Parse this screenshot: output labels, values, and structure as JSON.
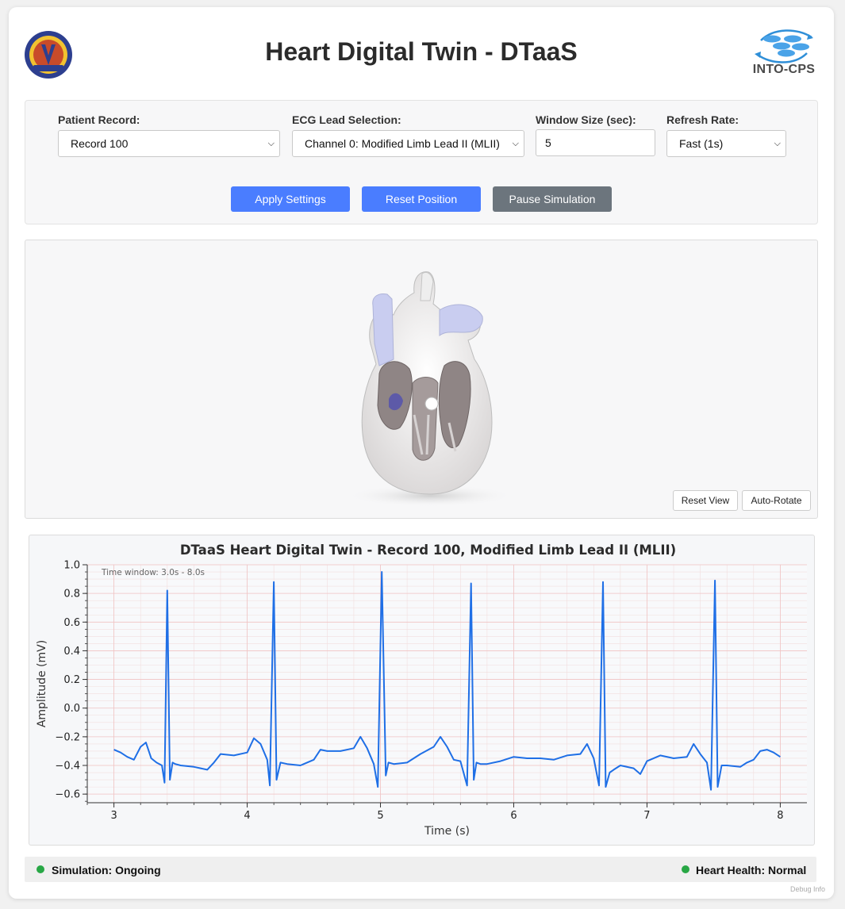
{
  "header": {
    "title": "Heart Digital Twin - DTaaS",
    "right_logo_text": "INTO-CPS"
  },
  "controls": {
    "patient_record": {
      "label": "Patient Record:",
      "value": "Record 100"
    },
    "ecg_lead": {
      "label": "ECG Lead Selection:",
      "value": "Channel 0: Modified Limb Lead II (MLII)"
    },
    "window_size": {
      "label": "Window Size (sec):",
      "value": "5"
    },
    "refresh_rate": {
      "label": "Refresh Rate:",
      "value": "Fast (1s)"
    },
    "buttons": {
      "apply": "Apply Settings",
      "reset_position": "Reset Position",
      "pause": "Pause Simulation"
    }
  },
  "viewer": {
    "reset_view": "Reset View",
    "auto_rotate": "Auto-Rotate"
  },
  "chart_data": {
    "type": "line",
    "title": "DTaaS Heart Digital Twin - Record 100, Modified Limb Lead II (MLII)",
    "xlabel": "Time (s)",
    "ylabel": "Amplitude (mV)",
    "annotation": "Time window: 3.0s - 8.0s",
    "xlim": [
      2.8,
      8.2
    ],
    "ylim": [
      -0.66,
      1.0
    ],
    "xticks": [
      3,
      4,
      5,
      6,
      7,
      8
    ],
    "yticks": [
      1.0,
      0.8,
      0.6,
      0.4,
      0.2,
      0.0,
      -0.2,
      -0.4,
      -0.6
    ],
    "ytick_labels": [
      "1.0",
      "0.8",
      "0.6",
      "0.4",
      "0.2",
      "0.0",
      "−0.2",
      "−0.4",
      "−0.6"
    ],
    "grid": true,
    "line_color": "#1f6fe6",
    "x": [
      3.0,
      3.05,
      3.1,
      3.15,
      3.2,
      3.24,
      3.28,
      3.32,
      3.36,
      3.38,
      3.4,
      3.42,
      3.44,
      3.46,
      3.5,
      3.6,
      3.7,
      3.75,
      3.8,
      3.9,
      4.0,
      4.05,
      4.1,
      4.15,
      4.17,
      4.2,
      4.22,
      4.25,
      4.3,
      4.4,
      4.5,
      4.55,
      4.6,
      4.7,
      4.8,
      4.85,
      4.9,
      4.95,
      4.98,
      5.01,
      5.04,
      5.06,
      5.1,
      5.2,
      5.3,
      5.4,
      5.45,
      5.5,
      5.55,
      5.6,
      5.65,
      5.68,
      5.7,
      5.72,
      5.75,
      5.8,
      5.9,
      6.0,
      6.1,
      6.2,
      6.3,
      6.4,
      6.5,
      6.55,
      6.6,
      6.64,
      6.67,
      6.69,
      6.72,
      6.75,
      6.8,
      6.9,
      6.95,
      7.0,
      7.1,
      7.2,
      7.3,
      7.35,
      7.4,
      7.45,
      7.48,
      7.51,
      7.53,
      7.56,
      7.6,
      7.7,
      7.75,
      7.8,
      7.85,
      7.9,
      7.95,
      8.0
    ],
    "y": [
      -0.29,
      -0.31,
      -0.34,
      -0.36,
      -0.27,
      -0.24,
      -0.35,
      -0.38,
      -0.4,
      -0.52,
      0.82,
      -0.5,
      -0.38,
      -0.39,
      -0.4,
      -0.41,
      -0.43,
      -0.38,
      -0.32,
      -0.33,
      -0.31,
      -0.21,
      -0.25,
      -0.36,
      -0.54,
      0.88,
      -0.5,
      -0.38,
      -0.39,
      -0.4,
      -0.36,
      -0.29,
      -0.3,
      -0.3,
      -0.28,
      -0.2,
      -0.28,
      -0.39,
      -0.55,
      0.95,
      -0.47,
      -0.38,
      -0.39,
      -0.38,
      -0.32,
      -0.27,
      -0.2,
      -0.27,
      -0.36,
      -0.37,
      -0.54,
      0.87,
      -0.5,
      -0.38,
      -0.39,
      -0.39,
      -0.37,
      -0.34,
      -0.35,
      -0.35,
      -0.36,
      -0.33,
      -0.32,
      -0.25,
      -0.35,
      -0.54,
      0.88,
      -0.55,
      -0.45,
      -0.43,
      -0.4,
      -0.42,
      -0.46,
      -0.37,
      -0.33,
      -0.35,
      -0.34,
      -0.25,
      -0.32,
      -0.38,
      -0.57,
      0.89,
      -0.55,
      -0.4,
      -0.4,
      -0.41,
      -0.38,
      -0.36,
      -0.3,
      -0.29,
      -0.31,
      -0.34
    ]
  },
  "status": {
    "simulation": "Simulation: Ongoing",
    "health": "Heart Health: Normal"
  },
  "footer": {
    "debug": "Debug Info"
  }
}
